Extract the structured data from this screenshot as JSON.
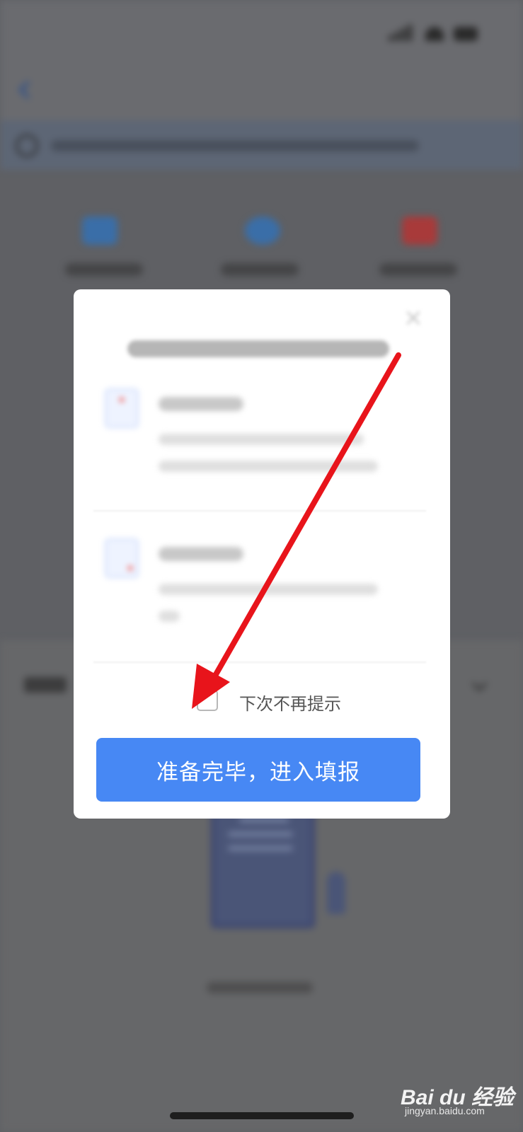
{
  "modal": {
    "checkbox_label": "下次不再提示",
    "confirm_button_label": "准备完毕，进入填报"
  },
  "watermark": {
    "brand": "Bai du 经验",
    "site": "jingyan.baidu.com"
  },
  "annotation": {
    "arrow_color": "#e8141b",
    "arrow_target": "dont-show-again-checkbox"
  },
  "colors": {
    "primary_button": "#4788f4",
    "overlay": "#5f6064"
  }
}
